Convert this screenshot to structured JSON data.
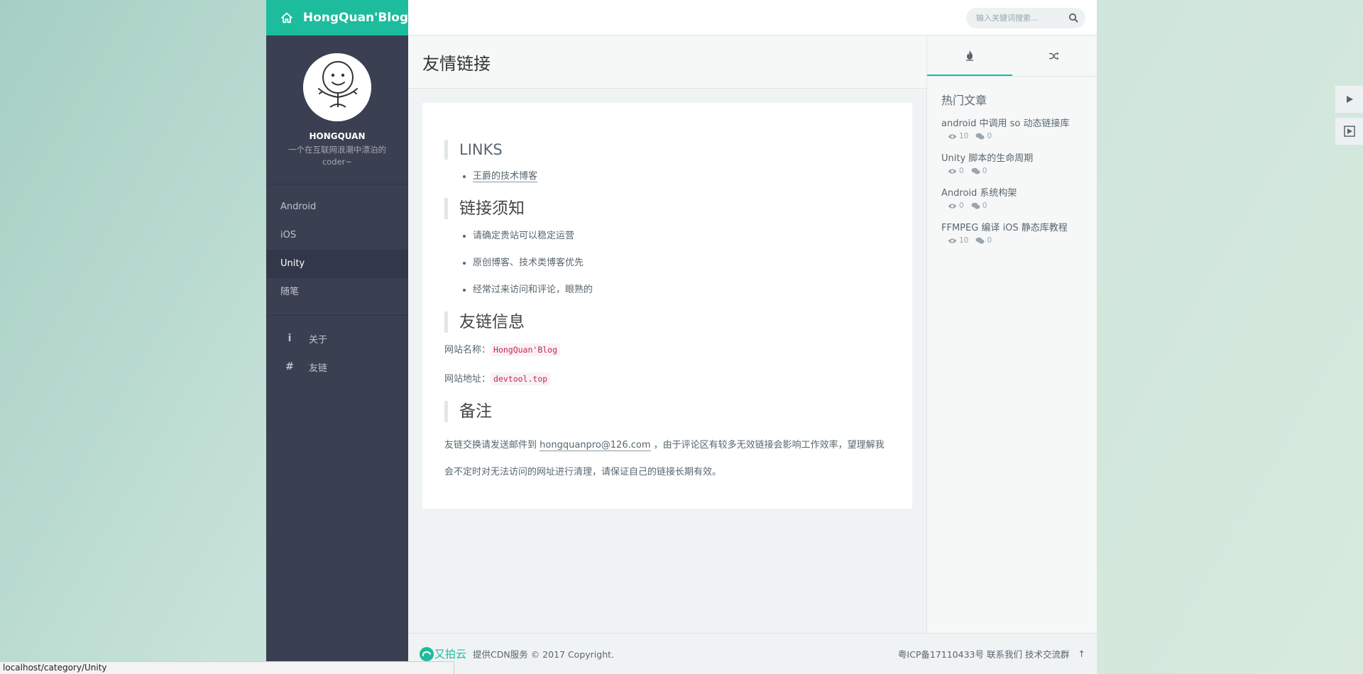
{
  "brand": {
    "title": "HongQuan'Blog"
  },
  "search": {
    "placeholder": "输入关键词搜索..."
  },
  "profile": {
    "name": "HONGQUAN",
    "motto": "一个在互联网浪潮中漂泊的coder~"
  },
  "nav": {
    "categories": [
      {
        "label": "Android"
      },
      {
        "label": "iOS"
      },
      {
        "label": "Unity"
      },
      {
        "label": "随笔"
      }
    ],
    "pages": [
      {
        "label": "关于",
        "icon": "info-icon"
      },
      {
        "label": "友链",
        "icon": "hash-icon"
      }
    ]
  },
  "page": {
    "title": "友情链接",
    "links_heading": "LINKS",
    "links": [
      "王爵的技术博客"
    ],
    "rules_heading": "链接须知",
    "rules": [
      "请确定贵站可以稳定运营",
      "原创博客、技术类博客优先",
      "经常过来访问和评论，眼熟的"
    ],
    "info_heading": "友链信息",
    "site_name_label": "网站名称：",
    "site_name": "HongQuan'Blog",
    "site_url_label": "网站地址：",
    "site_url": "devtool.top",
    "notes_heading": "备注",
    "note_before": "友链交换请发送邮件到 ",
    "note_email": "hongquanpro@126.com",
    "note_after": " ，由于评论区有较多无效链接会影响工作效率，望理解我会不定时对无法访问的网址进行清理，请保证自己的链接长期有效。"
  },
  "hot": {
    "title": "热门文章",
    "posts": [
      {
        "title": "android 中调用 so 动态链接库",
        "views": "10",
        "comments": "0"
      },
      {
        "title": "Unity 脚本的生命周期",
        "views": "0",
        "comments": "0"
      },
      {
        "title": "Android 系统构架",
        "views": "0",
        "comments": "0"
      },
      {
        "title": "FFMPEG 编译 iOS 静态库教程",
        "views": "10",
        "comments": "0"
      }
    ]
  },
  "footer": {
    "cdn_logo": "又拍云",
    "cdn_text": "提供CDN服务 © 2017 Copyright.",
    "icp": "粤ICP备17110433号",
    "contact": "联系我们",
    "group": "技术交流群",
    "top": "↑"
  },
  "statusbar": {
    "url": "localhost/category/Unity"
  },
  "colors": {
    "accent": "#1cbc9c",
    "aside": "#3a3f51"
  }
}
